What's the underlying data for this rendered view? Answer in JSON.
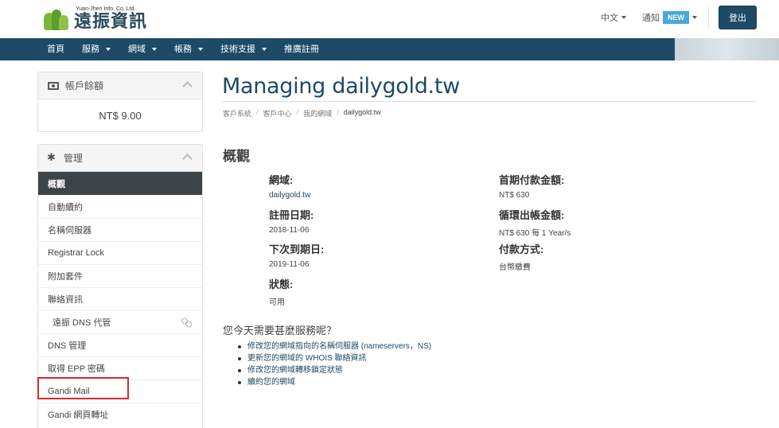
{
  "header": {
    "logo_en": "Yuan-Jhen Info. Co. Ltd.",
    "logo_zh": "遠振資訊",
    "lang": "中文",
    "notify": "通知",
    "new_badge": "NEW",
    "logout": "登出"
  },
  "nav": {
    "items": [
      "首頁",
      "服務",
      "網域",
      "帳務",
      "技術支援",
      "推廣註冊"
    ]
  },
  "sidebar": {
    "balance_title": "帳戶餘額",
    "balance_value": "NT$ 9.00",
    "manage_title": "管理",
    "menu": [
      "概觀",
      "自動續約",
      "名稱伺服器",
      "Registrar Lock",
      "附加套件",
      "聯絡資訊",
      "遠振 DNS 代管",
      "DNS 管理",
      "取得 EPP 密碼",
      "Gandi Mail",
      "Gandi 網頁轉址"
    ]
  },
  "main": {
    "title": "Managing dailygold.tw",
    "breadcrumb": [
      "客戶系統",
      "客戶中心",
      "我的網域",
      "dailygold.tw"
    ],
    "section": "概觀",
    "fields": {
      "domain_label": "網域:",
      "domain_value": "dailygold.tw",
      "reg_label": "註冊日期:",
      "reg_value": "2018-11-06",
      "due_label": "下次到期日:",
      "due_value": "2019-11-06",
      "status_label": "狀態:",
      "status_value": "可用",
      "first_label": "首期付款金額:",
      "first_value": "NT$ 630",
      "recurring_label": "循環出帳金額:",
      "recurring_value": "NT$ 630 每 1 Year/s",
      "payment_label": "付款方式:",
      "payment_value": "台幣繳費"
    },
    "help_title": "您今天需要甚麼服務呢？",
    "help_links": [
      "修改您的網域指向的名稱伺服器 (nameservers，NS)",
      "更新您的網域的 WHOIS 聯絡資訊",
      "修改您的網域轉移鎖定狀態",
      "續約您的網域"
    ]
  }
}
